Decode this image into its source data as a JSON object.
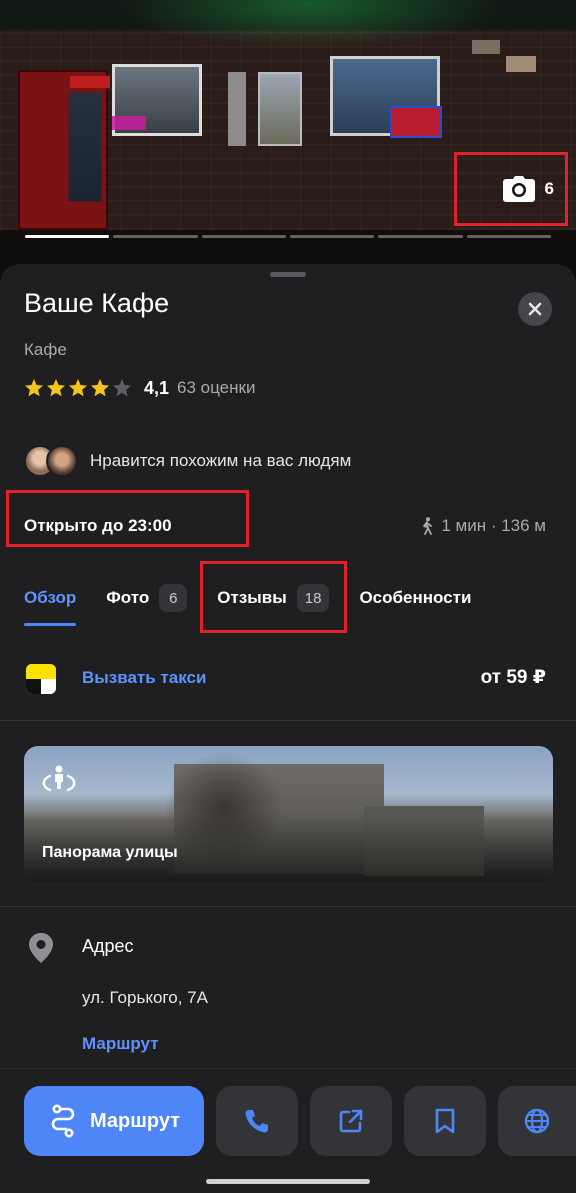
{
  "photo": {
    "count": "6",
    "slides": [
      true,
      false,
      false,
      false,
      false,
      false
    ]
  },
  "place": {
    "title": "Ваше Кафе",
    "category": "Кафе",
    "rating_value": "4,1",
    "rating_count": "63 оценки",
    "rating_stars": 4
  },
  "social": {
    "liked_text": "Нравится похожим на вас людям"
  },
  "status": {
    "open_text": "Открыто до 23:00",
    "walk_text": "1 мин · 136 м"
  },
  "tabs": [
    {
      "label": "Обзор",
      "badge": "",
      "active": true
    },
    {
      "label": "Фото",
      "badge": "6",
      "active": false
    },
    {
      "label": "Отзывы",
      "badge": "18",
      "active": false
    },
    {
      "label": "Особенности",
      "badge": "",
      "active": false
    }
  ],
  "taxi": {
    "label": "Вызвать такси",
    "price": "от 59 ₽"
  },
  "panorama": {
    "label": "Панорама улицы"
  },
  "address": {
    "title": "Адрес",
    "value": "ул. Горького, 7А",
    "route_link": "Маршрут"
  },
  "actions": {
    "route_label": "Маршрут",
    "icons": [
      "phone-icon",
      "share-icon",
      "bookmark-icon",
      "globe-icon"
    ]
  },
  "colors": {
    "accent": "#4e86f7",
    "link": "#5d93ff",
    "background": "#1f1f21",
    "star": "#f5c518",
    "highlight": "#e0222a"
  }
}
